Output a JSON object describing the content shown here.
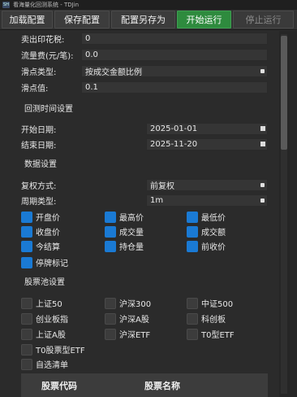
{
  "window": {
    "title": "看海量化回测系统 - TDJin",
    "icon_text": "SH"
  },
  "toolbar": {
    "buttons": [
      "加载配置",
      "保存配置",
      "配置另存为",
      "开始运行",
      "停止运行"
    ]
  },
  "fees": {
    "stamp_tax": {
      "label": "卖出印花税:",
      "value": "0"
    },
    "flow_fee": {
      "label": "流量费(元/笔):",
      "value": "0.0"
    },
    "slippage_type": {
      "label": "滑点类型:",
      "value": "按成交金额比例"
    },
    "slippage": {
      "label": "滑点值:",
      "value": "0.1"
    }
  },
  "backtest_time": {
    "section": "回测时间设置",
    "start": {
      "label": "开始日期:",
      "value": "2025-01-01"
    },
    "end": {
      "label": "结束日期:",
      "value": "2025-11-20"
    }
  },
  "data_settings": {
    "section": "数据设置",
    "adjust": {
      "label": "复权方式:",
      "value": "前复权"
    },
    "period": {
      "label": "周期类型:",
      "value": "1m"
    },
    "fields": [
      {
        "label": "开盘价",
        "checked": true
      },
      {
        "label": "最高价",
        "checked": true
      },
      {
        "label": "最低价",
        "checked": true
      },
      {
        "label": "收盘价",
        "checked": true
      },
      {
        "label": "成交量",
        "checked": true
      },
      {
        "label": "成交额",
        "checked": true
      },
      {
        "label": "今结算",
        "checked": true
      },
      {
        "label": "持仓量",
        "checked": true
      },
      {
        "label": "前收价",
        "checked": true
      },
      {
        "label": "停牌标记",
        "checked": true
      }
    ]
  },
  "stock_pool": {
    "section": "股票池设置",
    "options": [
      {
        "label": "上证50",
        "checked": false
      },
      {
        "label": "沪深300",
        "checked": false
      },
      {
        "label": "中证500",
        "checked": false
      },
      {
        "label": "创业板指",
        "checked": false
      },
      {
        "label": "沪深A股",
        "checked": false
      },
      {
        "label": "科创板",
        "checked": false
      },
      {
        "label": "上证A股",
        "checked": false
      },
      {
        "label": "沪深ETF",
        "checked": false
      },
      {
        "label": "T0型ETF",
        "checked": false
      },
      {
        "label": "T0股票型ETF",
        "checked": false
      },
      {
        "label": "自选清单",
        "checked": false
      }
    ],
    "table_headers": [
      "股票代码",
      "股票名称"
    ]
  }
}
